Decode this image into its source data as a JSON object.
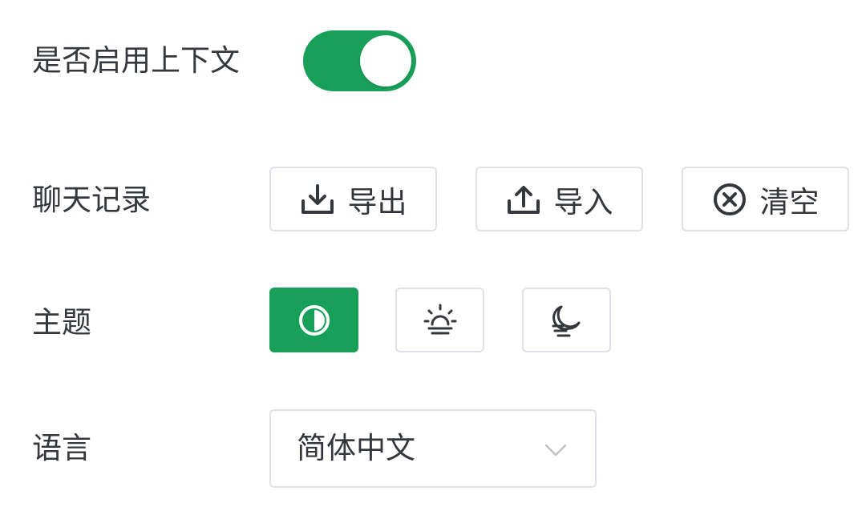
{
  "settings": {
    "context": {
      "label": "是否启用上下文",
      "enabled": true
    },
    "history": {
      "label": "聊天记录",
      "export_label": "导出",
      "import_label": "导入",
      "clear_label": "清空"
    },
    "theme": {
      "label": "主题",
      "options": [
        "auto-contrast-icon",
        "sun-icon",
        "moon-icon"
      ],
      "selected": "auto"
    },
    "language": {
      "label": "语言",
      "selected": "简体中文"
    }
  },
  "colors": {
    "accent": "#18a058",
    "border": "#e0e0e6",
    "text": "#333639"
  }
}
